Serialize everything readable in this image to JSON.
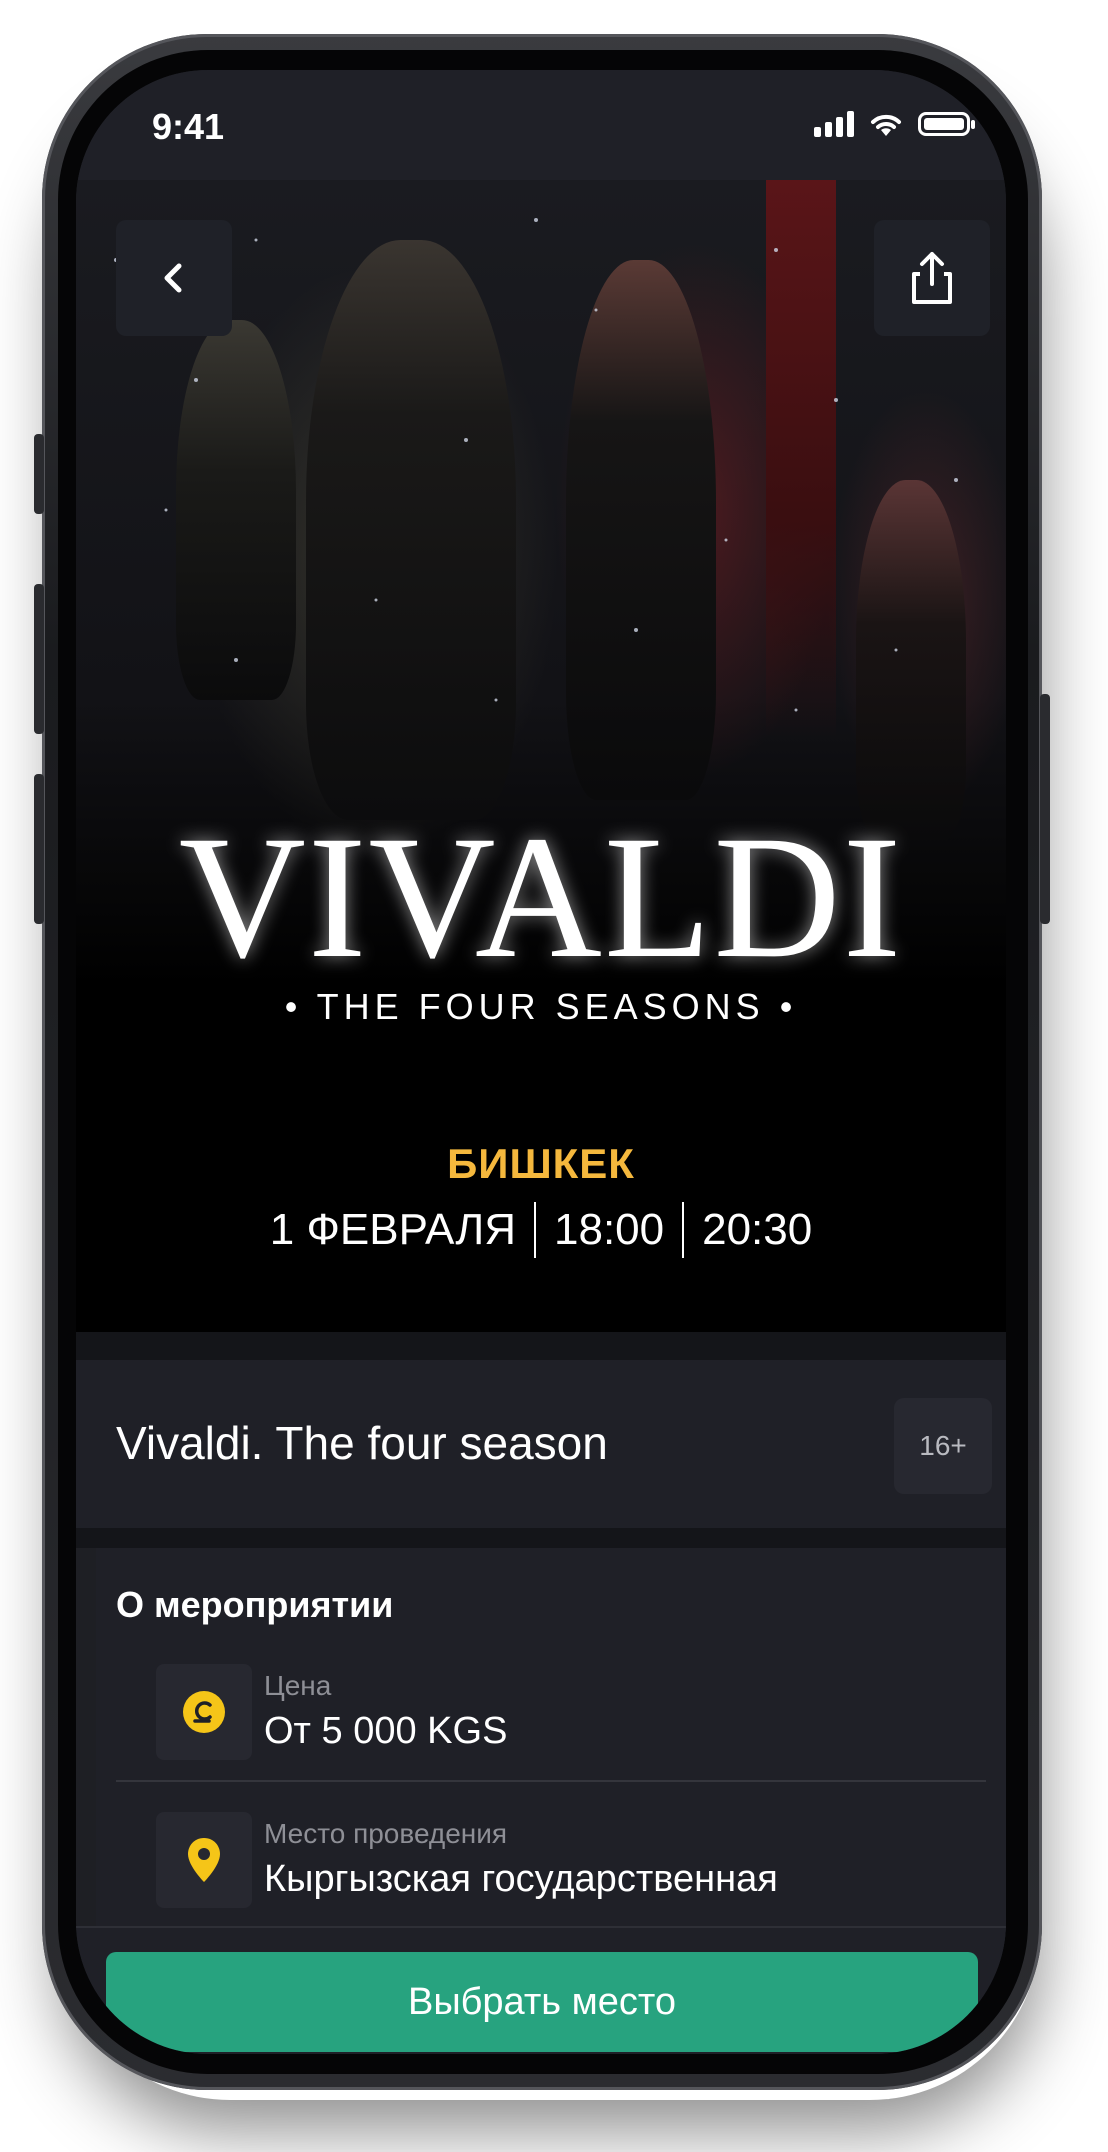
{
  "status_bar": {
    "time": "9:41"
  },
  "poster": {
    "title": "VIVALDI",
    "subtitle": "• THE FOUR SEASONS •",
    "city": "БИШКЕК",
    "date": "1 ФЕВРАЛЯ",
    "times": [
      "18:00",
      "20:30"
    ]
  },
  "event": {
    "title": "Vivaldi. The four season",
    "age_rating": "16+"
  },
  "about": {
    "title": "О мероприятии",
    "items": [
      {
        "icon": "som-currency-icon",
        "label": "Цена",
        "value": "От 5 000 KGS"
      },
      {
        "icon": "map-pin-icon",
        "label": "Место проведения",
        "value": "Кыргызская государственная"
      }
    ]
  },
  "cta": {
    "label": "Выбрать место"
  },
  "colors": {
    "accent_yellow": "#F5B83D",
    "cta_green": "#27A37F",
    "panel": "#1F2027",
    "icon_yellow": "#F5C518"
  }
}
